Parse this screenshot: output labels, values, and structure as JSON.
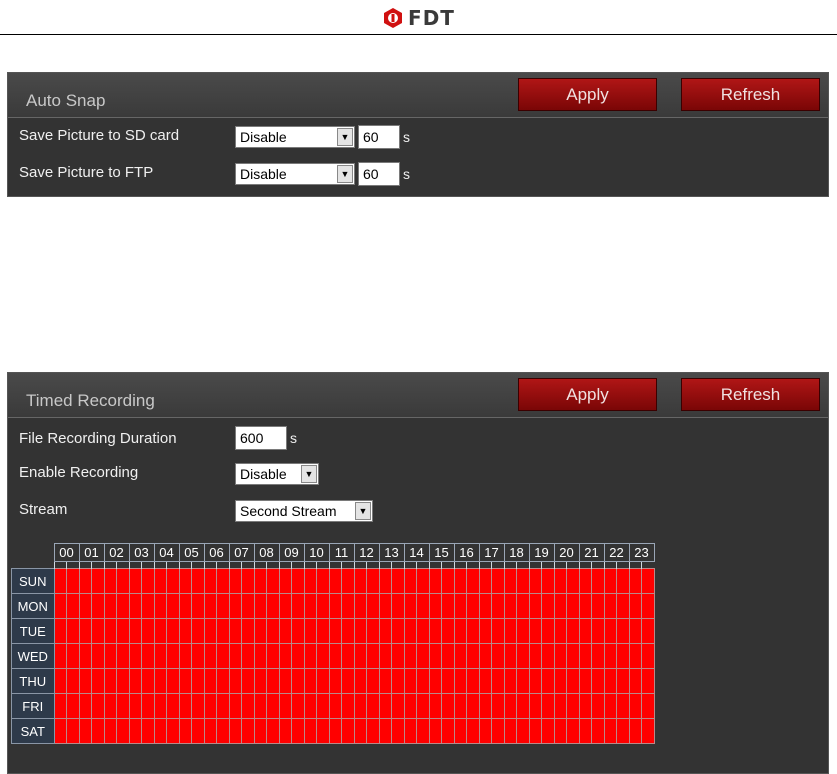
{
  "brand": {
    "name": "FDT"
  },
  "auto_snap": {
    "title": "Auto Snap",
    "apply_label": "Apply",
    "refresh_label": "Refresh",
    "sd": {
      "label": "Save Picture to SD card",
      "value": "Disable",
      "interval": "60",
      "unit": "s"
    },
    "ftp": {
      "label": "Save Picture to FTP",
      "value": "Disable",
      "interval": "60",
      "unit": "s"
    }
  },
  "timed_recording": {
    "title": "Timed Recording",
    "apply_label": "Apply",
    "refresh_label": "Refresh",
    "duration": {
      "label": "File Recording Duration",
      "value": "600",
      "unit": "s"
    },
    "enable": {
      "label": "Enable Recording",
      "value": "Disable"
    },
    "stream": {
      "label": "Stream",
      "value": "Second Stream"
    },
    "hours": [
      "00",
      "01",
      "02",
      "03",
      "04",
      "05",
      "06",
      "07",
      "08",
      "09",
      "10",
      "11",
      "12",
      "13",
      "14",
      "15",
      "16",
      "17",
      "18",
      "19",
      "20",
      "21",
      "22",
      "23"
    ],
    "days": [
      "SUN",
      "MON",
      "TUE",
      "WED",
      "THU",
      "FRI",
      "SAT"
    ],
    "schedule_color": "#ff0000"
  }
}
